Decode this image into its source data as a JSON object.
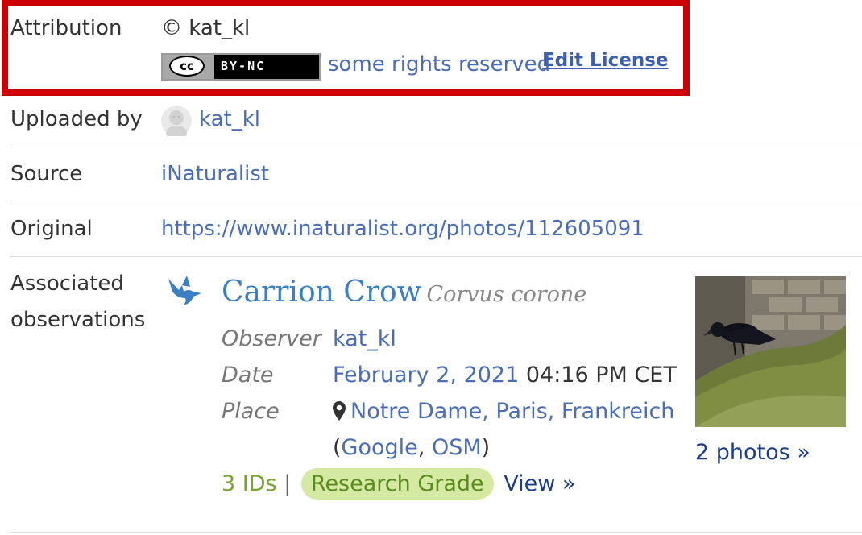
{
  "attribution": {
    "label": "Attribution",
    "owner": "© kat_kl",
    "badge_left": "cc",
    "badge_right": "BY-NC",
    "rights_text": "some rights reserved",
    "edit_license": "Edit License"
  },
  "uploaded_by": {
    "label": "Uploaded by",
    "user": "kat_kl"
  },
  "source": {
    "label": "Source",
    "value": "iNaturalist"
  },
  "original": {
    "label": "Original",
    "url": "https://www.inaturalist.org/photos/112605091"
  },
  "associated": {
    "label_line1": "Associated",
    "label_line2": "observations",
    "icon": "bird-icon",
    "common_name": "Carrion Crow",
    "scientific_name": "Corvus corone",
    "observer_label": "Observer",
    "observer": "kat_kl",
    "date_label": "Date",
    "date": "February 2, 2021",
    "time": "04:16 PM CET",
    "place_label": "Place",
    "place": "Notre Dame, Paris, Frankreich",
    "paren_open": "(",
    "google": "Google",
    "comma": ", ",
    "osm": "OSM",
    "paren_close": ")",
    "ids": "3 IDs",
    "separator": "|",
    "quality": "Research Grade",
    "view": "View »",
    "photos_link": "2 photos »"
  },
  "colors": {
    "highlight": "#cc0000",
    "link": "#4a6db8",
    "taxon": "#3b7fc4",
    "research_grade_bg": "#d4e9a2",
    "research_grade_text": "#5b8a1e",
    "ids": "#76a52a"
  }
}
